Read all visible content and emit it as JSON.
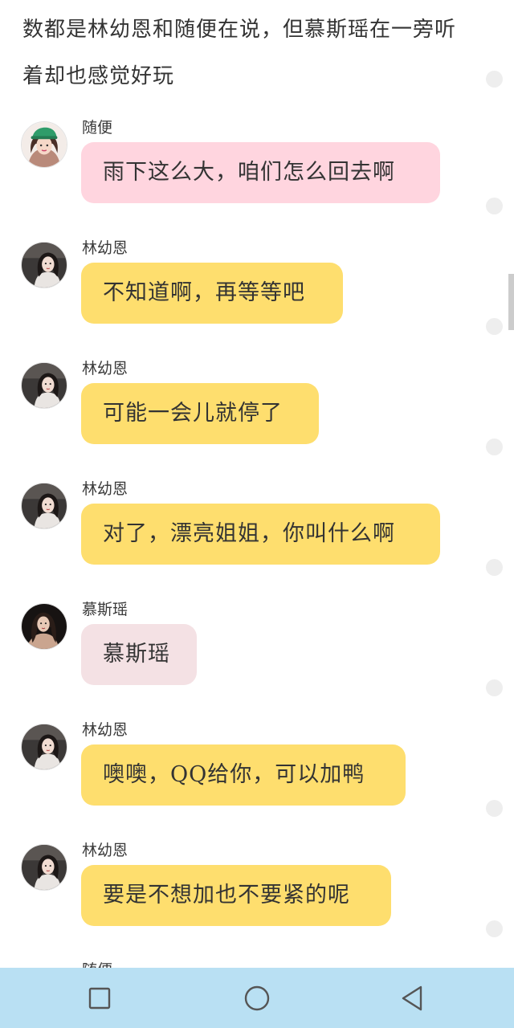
{
  "story": {
    "intro_text": "数都是林幼恩和随便在说，但慕斯瑶在一旁听着却也感觉好玩"
  },
  "colors": {
    "bubble_suibian": "#ffd5df",
    "bubble_linyouen": "#fede6e",
    "bubble_musiyao": "#f4e1e4",
    "nav_bar": "#b9e0f3"
  },
  "messages": [
    {
      "sender": "随便",
      "text": "雨下这么大，咱们怎么回去啊",
      "avatar_icon": "girl-green-cap-avatar-icon"
    },
    {
      "sender": "林幼恩",
      "text": "不知道啊，再等等吧",
      "avatar_icon": "girl-dark-hair-avatar-icon"
    },
    {
      "sender": "林幼恩",
      "text": "可能一会儿就停了",
      "avatar_icon": "girl-dark-hair-avatar-icon"
    },
    {
      "sender": "林幼恩",
      "text": "对了，漂亮姐姐，你叫什么啊",
      "avatar_icon": "girl-dark-hair-avatar-icon"
    },
    {
      "sender": "慕斯瑶",
      "text": "慕斯瑶",
      "avatar_icon": "long-hair-woman-avatar-icon"
    },
    {
      "sender": "林幼恩",
      "text": "噢噢，QQ给你，可以加鸭",
      "avatar_icon": "girl-dark-hair-avatar-icon"
    },
    {
      "sender": "林幼恩",
      "text": "要是不想加也不要紧的呢",
      "avatar_icon": "girl-dark-hair-avatar-icon"
    }
  ],
  "next_message_partial": {
    "sender": "随便"
  },
  "nav": {
    "recents_icon": "square-icon",
    "home_icon": "circle-icon",
    "back_icon": "triangle-back-icon"
  }
}
